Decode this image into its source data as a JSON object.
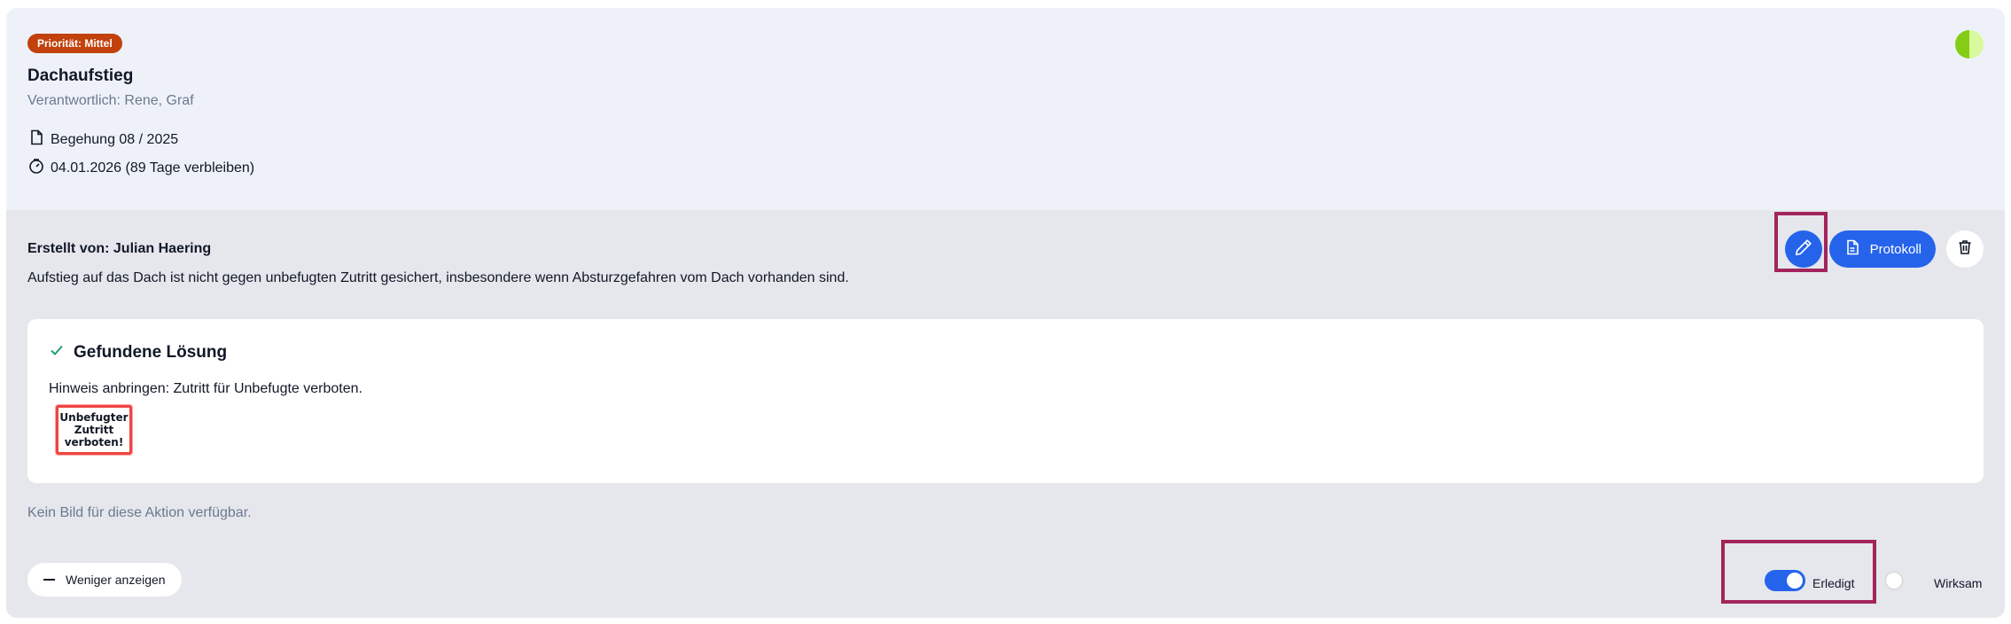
{
  "task": {
    "priority_badge": "Priorität: Mittel",
    "title": "Dachaufstieg",
    "responsible": "Verantwortlich: Rene, Graf",
    "inspection": "Begehung 08 / 2025",
    "deadline": "04.01.2026 (89 Tage verbleiben)",
    "status_indicator": {
      "colors": [
        "#84cc16",
        "#d9f99d"
      ]
    },
    "priority_color": "#c2410c"
  },
  "details": {
    "created_by": "Erstellt von: Julian Haering",
    "description": "Aufstieg auf das Dach ist nicht gegen unbefugten Zutritt gesichert, insbesondere wenn Absturzgefahren vom Dach vorhanden sind.",
    "actions": {
      "edit_icon": "pencil-icon",
      "protocol_label": "Protokoll",
      "protocol_icon": "document-icon",
      "delete_icon": "trash-icon"
    }
  },
  "solution": {
    "heading": "Gefundene Lösung",
    "text": "Hinweis anbringen: Zutritt für Unbefugte verboten.",
    "sign_lines": [
      "Unbefugter",
      "Zutritt",
      "verboten!"
    ]
  },
  "no_image_text": "Kein Bild für diese Aktion verfügbar.",
  "footer": {
    "show_less_label": "Weniger anzeigen",
    "toggles": [
      {
        "label": "Erledigt",
        "on": true
      },
      {
        "label": "Wirksam",
        "on": false
      }
    ]
  },
  "colors": {
    "accent": "#2563eb",
    "highlight": "#a3245b",
    "success": "#22a06b"
  }
}
